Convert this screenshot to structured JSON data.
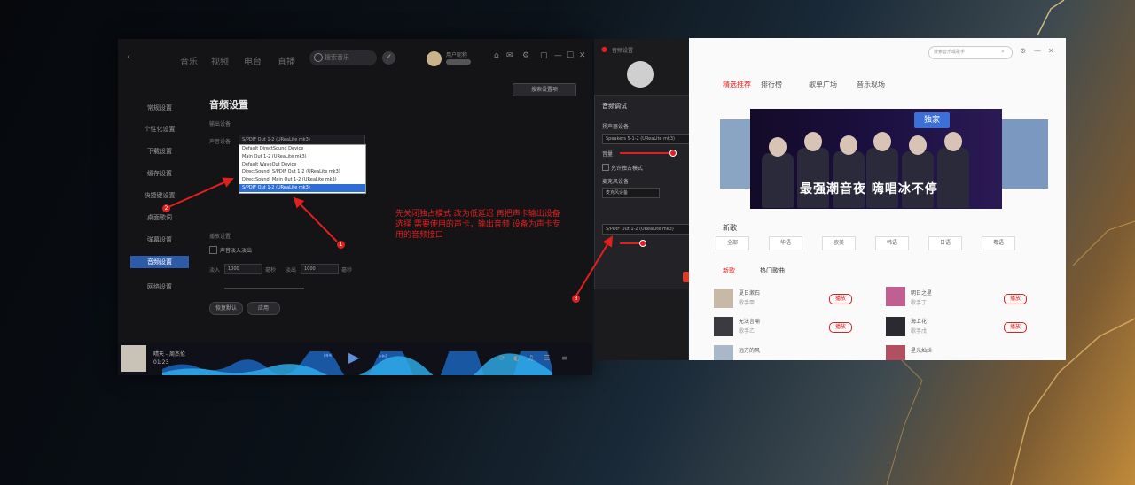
{
  "music_app": {
    "nav_tabs": [
      "音乐",
      "视频",
      "电台",
      "直播"
    ],
    "search_placeholder": "搜索音乐",
    "username": "用户昵称",
    "sidebar": [
      "常规设置",
      "个性化设置",
      "下载设置",
      "缓存设置",
      "快捷键设置",
      "桌面歌词",
      "弹幕设置",
      "音频设置",
      "网络设置"
    ],
    "sidebar_active_index": 7,
    "heading": "音频设置",
    "output_label": "输出设备",
    "device_label": "声音设备",
    "current_device": "S/PDIF Out 1-2 (UReaLite mk3)",
    "dropdown_options": [
      "Default DirectSound Device",
      "Main Out 1-2 (UReaLite mk3)",
      "Default WaveOut Device",
      "DirectSound: S/PDIF Out 1-2 (UReaLite mk3)",
      "DirectSound: Main Out 1-2 (UReaLite mk3)",
      "S/PDIF Out 1-2 (UReaLite mk3)"
    ],
    "selected_option_index": 5,
    "fade_label": "播放设置",
    "fade_checkbox": "声音淡入淡出",
    "fade_in": "淡入",
    "fade_in_value": "1000",
    "fade_out": "淡出",
    "fade_out_value": "1000",
    "unit": "毫秒",
    "btn_reset": "恢复默认",
    "btn_apply": "应用",
    "search_settings": "搜索设置项",
    "now_playing": "晴天 - 周杰伦",
    "time": "01:23"
  },
  "annotation": {
    "text": "先关闭独占模式 改为低延迟 再把声卡输出设备选择 需要使用的声卡，输出音频 设备为声卡专用的音频接口",
    "badges": [
      "1",
      "2",
      "3"
    ]
  },
  "mid_window": {
    "title": "音频设置",
    "dialog_title": "音频调试",
    "section_play": "扬声器设备",
    "play_device": "Speakers 5-1-2 (UReaLite mk3)",
    "volume_label": "音量",
    "checkbox": "允许独占模式",
    "section_rec": "麦克风设备",
    "rec_device": "S/PDIF Out 1-2 (UReaLite mk3)",
    "test_btn": "测试",
    "confirm_btn": "确定"
  },
  "web_window": {
    "search_placeholder": "搜索音乐或歌手",
    "tabs": [
      "精选推荐",
      "排行榜",
      "歌单广场",
      "音乐现场"
    ],
    "active_tab": 0,
    "banner_tag": "独家",
    "banner_title": "最强潮音夜 嗨唱冰不停",
    "chips": [
      "全部",
      "华语",
      "欧美",
      "韩语",
      "日语",
      "粤语"
    ],
    "section_new": "新歌",
    "section_hot": "热门歌曲",
    "songs": [
      {
        "title": "夏日漱石",
        "artist": "歌手甲"
      },
      {
        "title": "无法言喻",
        "artist": "歌手乙"
      },
      {
        "title": "远方的风",
        "artist": "歌手丙"
      },
      {
        "title": "明日之星",
        "artist": "歌手丁"
      },
      {
        "title": "海上花",
        "artist": "歌手戊"
      },
      {
        "title": "星光灿烂",
        "artist": "歌手己"
      }
    ],
    "play_label": "播放"
  },
  "colors": {
    "accent_blue": "#2d5ba8",
    "accent_red": "#e02020"
  }
}
